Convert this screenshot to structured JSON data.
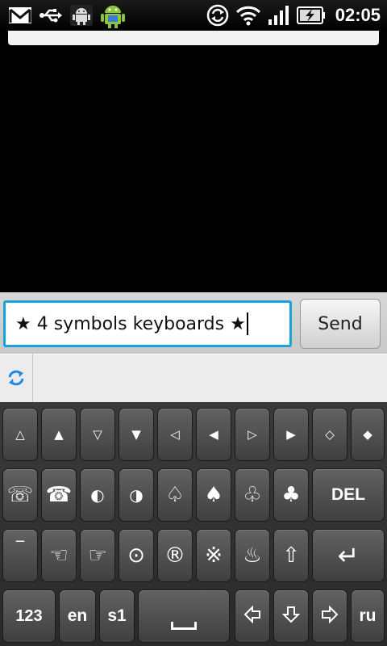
{
  "status_bar": {
    "time": "02:05",
    "icons": [
      "gmail-icon",
      "usb-icon",
      "android-debug-icon",
      "android-market-icon",
      "sync-icon",
      "wifi-icon",
      "signal-icon",
      "battery-charging-icon"
    ]
  },
  "compose": {
    "message_text": "★ 4 symbols keyboards ★",
    "send_label": "Send"
  },
  "suggestions": {
    "sync_icon": "refresh-icon"
  },
  "keyboard": {
    "row1": [
      "△",
      "▲",
      "▽",
      "▼",
      "◁",
      "◀",
      "▷",
      "▶",
      "◇",
      "◆"
    ],
    "row2": [
      "☏",
      "☎",
      "◐",
      "◑",
      "♤",
      "♠",
      "♧",
      "♣",
      "DEL"
    ],
    "row3": [
      "‾",
      "☜",
      "☞",
      "⊙",
      "®",
      "※",
      "♨",
      "⇧",
      "↵"
    ],
    "row4": [
      "123",
      "en",
      "s1",
      "␣",
      "⇦",
      "⇩",
      "⇨",
      "ru"
    ]
  }
}
